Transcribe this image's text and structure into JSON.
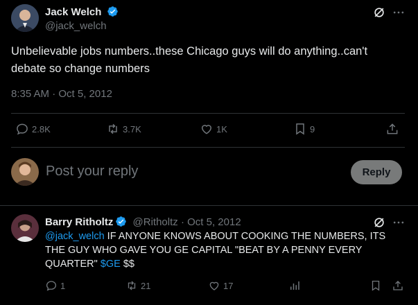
{
  "colors": {
    "background": "#000000",
    "text": "#e7e9ea",
    "muted": "#71767b",
    "accent": "#1d9bf0",
    "divider": "#2f3336"
  },
  "main_tweet": {
    "author_name": "Jack Welch",
    "handle": "@jack_welch",
    "verified_icon": "verified-badge-icon",
    "text": "Unbelievable jobs numbers..these Chicago guys will do anything..can't debate so change numbers",
    "timestamp": "8:35 AM · Oct 5, 2012",
    "actions": {
      "replies": "2.8K",
      "retweets": "3.7K",
      "likes": "1K",
      "bookmarks": "9"
    }
  },
  "reply_composer": {
    "placeholder": "Post your reply",
    "button_label": "Reply"
  },
  "reply_tweet": {
    "author_name": "Barry Ritholtz",
    "handle": "@Ritholtz",
    "dot": "·",
    "date": "Oct 5, 2012",
    "mention": "@jack_welch",
    "text_part1": " IF ANYONE KNOWS ABOUT COOKING THE NUMBERS, ITS THE GUY WHO GAVE YOU GE CAPITAL \"BEAT BY A PENNY EVERY QUARTER\" ",
    "cashtag": "$GE",
    "text_part2": " $$",
    "actions": {
      "replies": "1",
      "retweets": "21",
      "likes": "17"
    }
  }
}
